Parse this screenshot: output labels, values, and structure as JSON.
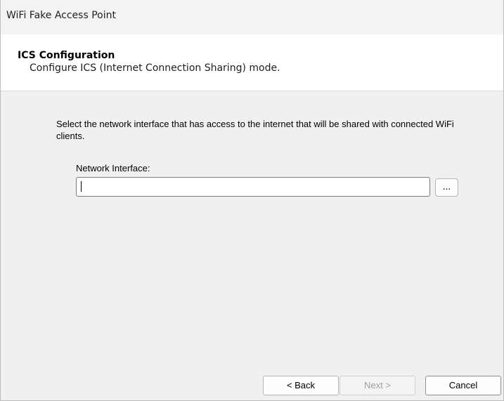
{
  "window": {
    "title": "WiFi Fake Access Point"
  },
  "header": {
    "title": "ICS Configuration",
    "subtitle": "Configure ICS (Internet Connection Sharing) mode."
  },
  "main": {
    "description": "Select the network interface that has access to the internet that will be shared with connected WiFi clients.",
    "network_interface": {
      "label": "Network Interface:",
      "value": "",
      "browse_label": "..."
    }
  },
  "footer": {
    "back_label": "< Back",
    "next_label": "Next >",
    "cancel_label": "Cancel"
  },
  "colors": {
    "background": "#f0f0f0",
    "header_background": "#ffffff",
    "disabled_text": "#a0a0a0"
  }
}
